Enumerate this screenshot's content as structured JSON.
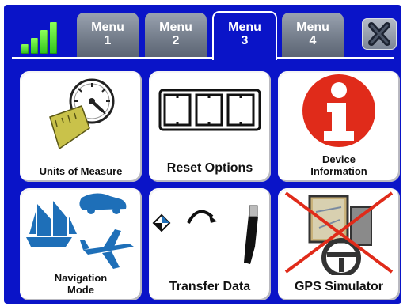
{
  "tabs": [
    {
      "line1": "Menu",
      "line2": "1",
      "active": false
    },
    {
      "line1": "Menu",
      "line2": "2",
      "active": false
    },
    {
      "line1": "Menu",
      "line2": "3",
      "active": true
    },
    {
      "line1": "Menu",
      "line2": "4",
      "active": false
    }
  ],
  "tiles": {
    "units": {
      "label": "Units of Measure"
    },
    "reset": {
      "label": "Reset Options"
    },
    "device": {
      "line1": "Device",
      "line2": "Information"
    },
    "navigation": {
      "line1": "Navigation",
      "line2": "Mode"
    },
    "transfer": {
      "label": "Transfer Data"
    },
    "gps": {
      "label": "GPS Simulator"
    }
  },
  "icons": {
    "signal": "signal-strength-icon",
    "close": "close-icon",
    "units": "gauge-ruler-icon",
    "reset": "digital-counter-icon",
    "device": "info-icon",
    "navigation": "vehicles-icon",
    "transfer": "usb-transfer-icon",
    "gps": "gps-simulator-disabled-icon"
  },
  "colors": {
    "background": "#0a14c8",
    "tab_inactive": "#7a8494",
    "info_red": "#e02b1a",
    "navigation_blue": "#1e6fb8",
    "signal_green": "#3fd82a"
  }
}
